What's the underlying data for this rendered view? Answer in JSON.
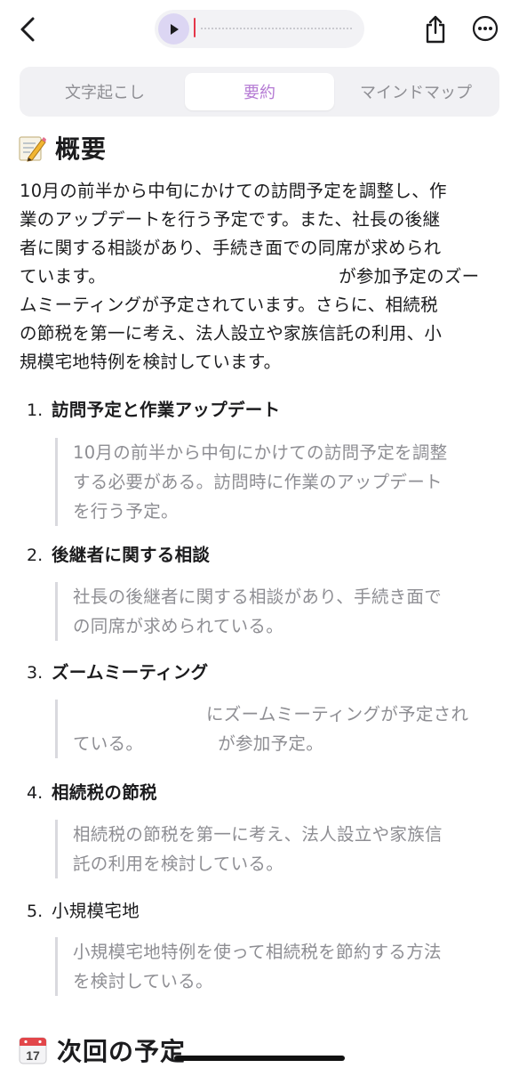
{
  "tabs": {
    "transcript": "文字起こし",
    "summary": "要約",
    "mindmap": "マインドマップ",
    "active": "summary"
  },
  "overview": {
    "title": "概要",
    "line1": "10月の前半から中旬にかけての訪問予定を調整し、作",
    "line2": "業のアップデートを行う予定です。また、社長の後継",
    "line3": "者に関する相談があり、手続き面での同席が求められ",
    "line4a": "ています。",
    "line4b": "が参加予定のズー",
    "line5": "ムミーティングが予定されています。さらに、相続税",
    "line6": "の節税を第一に考え、法人設立や家族信託の利用、小",
    "line7": "規模宅地特例を検討しています。"
  },
  "items": [
    {
      "num": "1.",
      "title": "訪問予定と作業アップデート",
      "l1": "10月の前半から中旬にかけての訪問予定を調整",
      "l2": "する必要がある。訪問時に作業のアップデート",
      "l3": "を行う予定。"
    },
    {
      "num": "2.",
      "title": "後継者に関する相談",
      "l1": "社長の後継者に関する相談があり、手続き面で",
      "l2": "の同席が求められている。"
    },
    {
      "num": "3.",
      "title": "ズームミーティング",
      "l1": "にズームミーティングが予定され",
      "l2a": "ている。",
      "l2b": "が参加予定。"
    },
    {
      "num": "4.",
      "title": "相続税の節税",
      "l1": "相続税の節税を第一に考え、法人設立や家族信",
      "l2": "託の利用を検討している。"
    },
    {
      "num": "5.",
      "title": "小規模宅地",
      "l1": "小規模宅地特例を使って相続税を節約する方法",
      "l2": "を検討している。"
    }
  ],
  "next": {
    "title": "次回の予定",
    "calendar_day": "17"
  },
  "icons": {
    "back": "chevron-left-icon",
    "play": "play-icon",
    "share": "share-icon",
    "more": "ellipsis-circle-icon",
    "memo": "memo-emoji-icon",
    "calendar": "calendar-emoji-icon"
  },
  "colors": {
    "accent": "#b57bd4",
    "scrubber": "#e5374a",
    "muted_text": "#8e8e93"
  }
}
